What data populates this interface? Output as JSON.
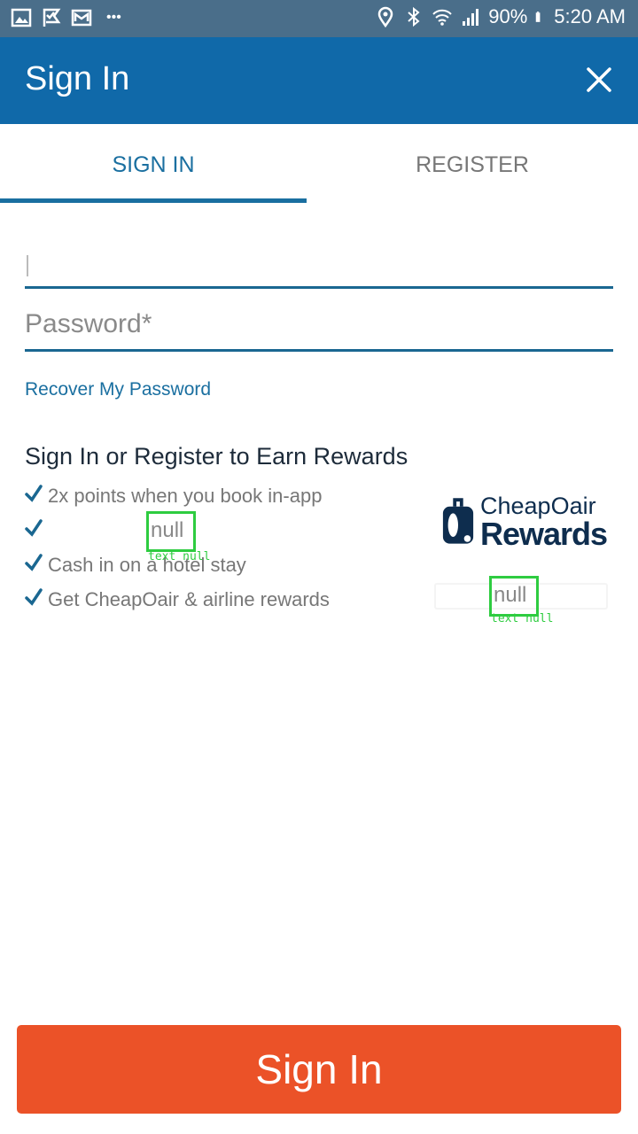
{
  "status_bar": {
    "battery": "90%",
    "time": "5:20 AM",
    "dots": "•••",
    "icons": [
      "image-icon",
      "flag-icon",
      "mail-icon",
      "location-icon",
      "bluetooth-icon",
      "wifi-icon",
      "signal-icon",
      "battery-icon"
    ]
  },
  "app_bar": {
    "title": "Sign In",
    "close_icon": "close-icon"
  },
  "tabs": [
    {
      "label": "SIGN IN",
      "active": true
    },
    {
      "label": "REGISTER",
      "active": false
    }
  ],
  "form": {
    "email_value": "",
    "password_placeholder": "Password*",
    "recover_link": "Recover My Password"
  },
  "rewards": {
    "heading": "Sign In or Register to Earn Rewards",
    "benefits": [
      "2x points when you book in-app",
      "",
      "Cash in on a hotel stay",
      "Get CheapOair & airline rewards"
    ],
    "logo_line1": "CheapOair",
    "logo_line2": "Rewards"
  },
  "overlays": [
    {
      "text": "null",
      "caption": "text null"
    },
    {
      "text": "null",
      "caption": "text null"
    }
  ],
  "button": {
    "label": "Sign In"
  },
  "colors": {
    "status_bar": "#4a6e8a",
    "app_bar": "#1069a9",
    "accent": "#1a6fa0",
    "button": "#eb5228",
    "logo": "#0e2d4e"
  }
}
